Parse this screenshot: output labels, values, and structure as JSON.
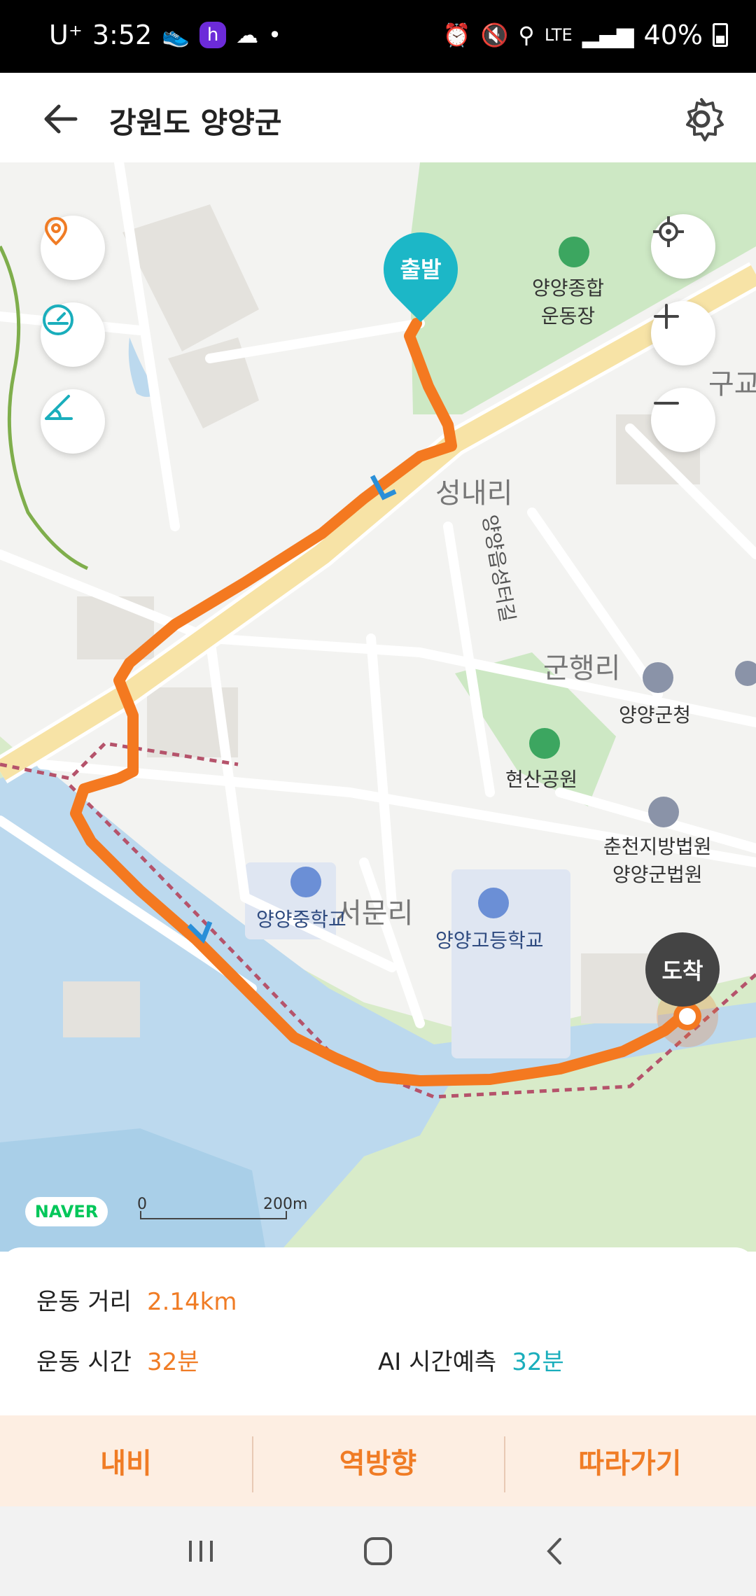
{
  "status_bar": {
    "carrier": "U⁺",
    "time": "3:52",
    "network": "LTE",
    "battery": "40%"
  },
  "header": {
    "title": "강원도 양양군"
  },
  "map": {
    "start_label": "출발",
    "end_label": "도착",
    "area_labels": [
      "성내리",
      "군행리",
      "서문리",
      "구교"
    ],
    "road_label": "양양읍성터길",
    "poi": {
      "stadium": "양양종합\n운동장",
      "county_office": "양양군청",
      "park": "현산공원",
      "court": "춘천지방법원\n양양군법원",
      "middle_school": "양양중학교",
      "high_school": "양양고등학교"
    },
    "brand": "NAVER",
    "scale_start": "0",
    "scale_end": "200m"
  },
  "info": {
    "distance_label": "운동 거리",
    "distance_value": "2.14km",
    "time_label": "운동 시간",
    "time_value": "32분",
    "ai_label": "AI 시간예측",
    "ai_value": "32분"
  },
  "actions": {
    "navi": "내비",
    "reverse": "역방향",
    "follow": "따라가기"
  },
  "colors": {
    "route": "#f47920",
    "accent_teal": "#1cb7c7",
    "accent_orange": "#f07c25"
  }
}
